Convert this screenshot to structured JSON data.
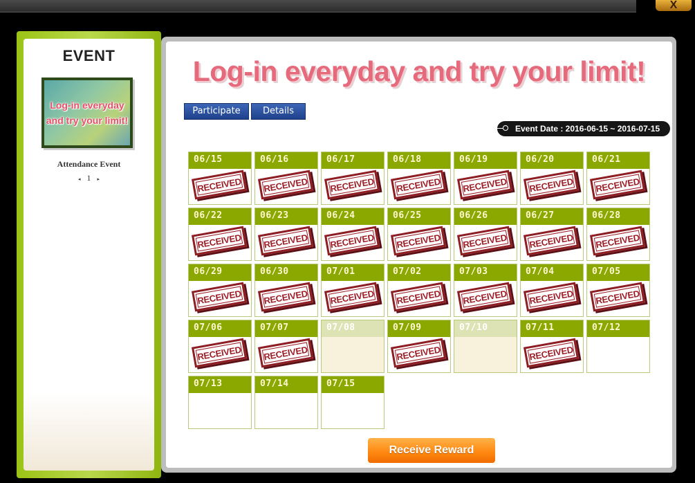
{
  "window": {
    "close_label": "X"
  },
  "sidebar": {
    "title": "EVENT",
    "thumbnail_text": "Log-in everyday and try your limit!",
    "thumbnail_label": "Attendance Event",
    "pager": {
      "prev": "◂",
      "page": "1",
      "next": "▸"
    }
  },
  "main": {
    "headline": "Log-in everyday and try your limit!",
    "buttons": {
      "participate": "Participate",
      "details": "Details"
    },
    "event_date": "Event Date : 2016-06-15 ~ 2016-07-15",
    "reward_button": "Receive Reward",
    "stamp_label": "RECEIVED"
  },
  "calendar": {
    "days": [
      {
        "date": "06/15",
        "status": "received"
      },
      {
        "date": "06/16",
        "status": "received"
      },
      {
        "date": "06/17",
        "status": "received"
      },
      {
        "date": "06/18",
        "status": "received"
      },
      {
        "date": "06/19",
        "status": "received"
      },
      {
        "date": "06/20",
        "status": "received"
      },
      {
        "date": "06/21",
        "status": "received"
      },
      {
        "date": "06/22",
        "status": "received"
      },
      {
        "date": "06/23",
        "status": "received"
      },
      {
        "date": "06/24",
        "status": "received"
      },
      {
        "date": "06/25",
        "status": "received"
      },
      {
        "date": "06/26",
        "status": "received"
      },
      {
        "date": "06/27",
        "status": "received"
      },
      {
        "date": "06/28",
        "status": "received"
      },
      {
        "date": "06/29",
        "status": "received"
      },
      {
        "date": "06/30",
        "status": "received"
      },
      {
        "date": "07/01",
        "status": "received"
      },
      {
        "date": "07/02",
        "status": "received"
      },
      {
        "date": "07/03",
        "status": "received"
      },
      {
        "date": "07/04",
        "status": "received"
      },
      {
        "date": "07/05",
        "status": "received"
      },
      {
        "date": "07/06",
        "status": "received"
      },
      {
        "date": "07/07",
        "status": "received"
      },
      {
        "date": "07/08",
        "status": "missed"
      },
      {
        "date": "07/09",
        "status": "received"
      },
      {
        "date": "07/10",
        "status": "missed"
      },
      {
        "date": "07/11",
        "status": "received"
      },
      {
        "date": "07/12",
        "status": "empty"
      },
      {
        "date": "07/13",
        "status": "empty"
      },
      {
        "date": "07/14",
        "status": "empty"
      },
      {
        "date": "07/15",
        "status": "empty"
      }
    ]
  },
  "colors": {
    "header_green": "#8aa800",
    "stamp_red": "#9e1e28",
    "headline_pink": "#e46a7c",
    "button_blue": "#2a4f9e",
    "reward_orange": "#ff8a12"
  }
}
